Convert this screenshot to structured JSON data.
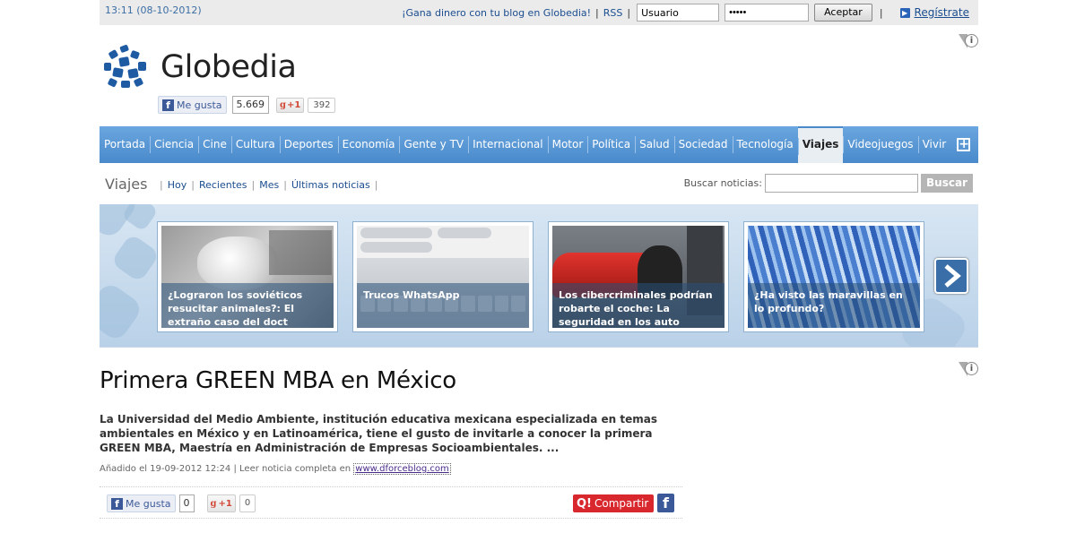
{
  "topbar": {
    "timestamp": "13:11 (08-10-2012)",
    "promo_link": "¡Gana dinero con tu blog en Globedia!",
    "rss_link": "RSS",
    "username_value": "Usuario",
    "password_value": "•••••",
    "login_button": "Aceptar",
    "register_link": "Regístrate"
  },
  "logo": {
    "text": "Globedia"
  },
  "social": {
    "fb_like_label": "Me gusta",
    "fb_count": "5.669",
    "gplus_label": "+1",
    "gplus_count": "392"
  },
  "nav": {
    "items": [
      "Portada",
      "Ciencia",
      "Cine",
      "Cultura",
      "Deportes",
      "Economía",
      "Gente y TV",
      "Internacional",
      "Motor",
      "Política",
      "Salud",
      "Sociedad",
      "Tecnología",
      "Viajes",
      "Videojuegos",
      "Vivir"
    ],
    "active": "Viajes"
  },
  "section": {
    "title": "Viajes",
    "links": [
      "Hoy",
      "Recientes",
      "Mes",
      "Últimas noticias"
    ],
    "search_label": "Buscar noticias:",
    "search_value": "",
    "search_button": "Buscar"
  },
  "carousel": {
    "slides": [
      {
        "caption": "¿Lograron los soviéticos resucitar animales?: El extraño caso del doct"
      },
      {
        "caption": "Trucos WhatsApp"
      },
      {
        "caption": "Los cibercriminales podrían robarte el coche: La seguridad en los auto"
      },
      {
        "caption": "¿Ha visto las maravillas en lo profundo?"
      }
    ]
  },
  "article": {
    "title": "Primera GREEN MBA en México",
    "summary": "La Universidad del Medio Ambiente, institución educativa mexicana especializada en temas ambientales en México y en Latinoamérica, tiene el gusto de invitarle a conocer la primera GREEN MBA, Maestría en Administración de Empresas Socioambientales. ...",
    "meta_prefix": "Añadido el 19-09-2012 12:24 | Leer noticia completa en",
    "source_link": "www.dforceblog.com",
    "fb_like_label": "Me gusta",
    "fb_count": "0",
    "gplus_label": "+1",
    "gplus_count": "0",
    "share_button": "Compartir"
  },
  "colors": {
    "nav_blue": "#4a8acb",
    "link_blue": "#1a4d8f",
    "share_red": "#d9272e",
    "facebook": "#3b5998"
  }
}
